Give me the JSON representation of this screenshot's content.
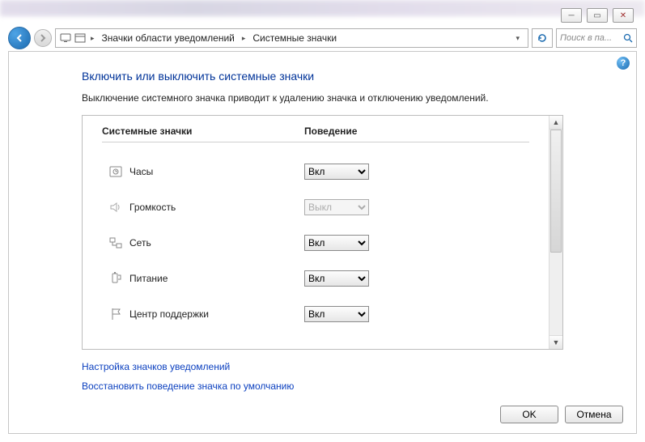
{
  "titlebar": {
    "minimize": "─",
    "restore": "▭",
    "close": "✕"
  },
  "breadcrumb": {
    "item1": "Значки области уведомлений",
    "item2": "Системные значки"
  },
  "search": {
    "placeholder": "Поиск в па..."
  },
  "page": {
    "title": "Включить или выключить системные значки",
    "description": "Выключение системного значка приводит к удалению значка и отключению уведомлений."
  },
  "columns": {
    "col1": "Системные значки",
    "col2": "Поведение"
  },
  "options": {
    "on": "Вкл",
    "off": "Выкл"
  },
  "rows": [
    {
      "label": "Часы",
      "value": "Вкл",
      "disabled": false
    },
    {
      "label": "Громкость",
      "value": "Выкл",
      "disabled": true
    },
    {
      "label": "Сеть",
      "value": "Вкл",
      "disabled": false
    },
    {
      "label": "Питание",
      "value": "Вкл",
      "disabled": false
    },
    {
      "label": "Центр поддержки",
      "value": "Вкл",
      "disabled": false
    }
  ],
  "links": {
    "customize": "Настройка значков уведомлений",
    "restore": "Восстановить поведение значка по умолчанию"
  },
  "buttons": {
    "ok": "OK",
    "cancel": "Отмена"
  }
}
